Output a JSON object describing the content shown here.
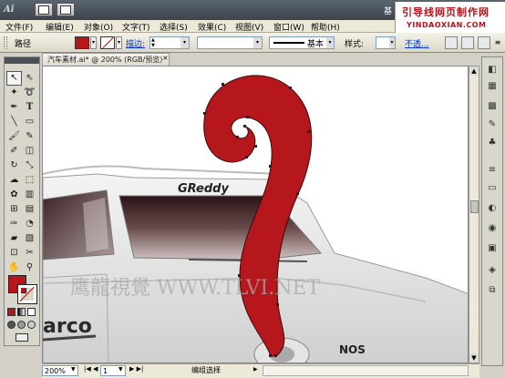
{
  "app": {
    "logo": "Ai",
    "ext_label": "基",
    "watermark_title": "引导线网页制作网",
    "watermark_sub": "YINDAOXIAN.COM"
  },
  "menu": [
    "文件(F)",
    "编辑(E)",
    "对象(O)",
    "文字(T)",
    "选择(S)",
    "效果(C)",
    "视图(V)",
    "窗口(W)",
    "帮助(H)"
  ],
  "control": {
    "selection_label": "路径",
    "fill_color": "#b5171c",
    "stroke_link": "描边:",
    "brush_label": "基本",
    "style_label": "样式:",
    "opacity_link": "不透..."
  },
  "document": {
    "tab_title": "汽车素材.ai* @ 200% (RGB/预览)",
    "close": "×",
    "banner_text": "GReddy",
    "side_text": "arco",
    "badge_text": "NOS",
    "watermark": "鹰龍視覺 WWW.TLVI.NET"
  },
  "status": {
    "zoom": "200%",
    "page": "1",
    "tool_status": "编组选择"
  },
  "tools": [
    "selection-tool",
    "direct-selection-tool",
    "magic-wand-tool",
    "lasso-tool",
    "pen-tool",
    "type-tool",
    "line-tool",
    "rectangle-tool",
    "paintbrush-tool",
    "pencil-tool",
    "blob-brush-tool",
    "eraser-tool",
    "rotate-tool",
    "scale-tool",
    "warp-tool",
    "free-transform-tool",
    "symbol-sprayer-tool",
    "column-graph-tool",
    "mesh-tool",
    "gradient-tool",
    "eyedropper-tool",
    "blend-tool",
    "live-paint-tool",
    "live-paint-select-tool",
    "artboard-tool",
    "slice-tool",
    "hand-tool",
    "zoom-tool"
  ]
}
